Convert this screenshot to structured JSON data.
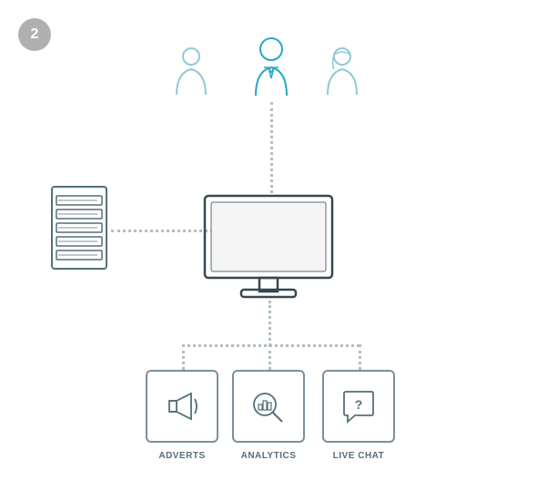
{
  "badge": {
    "number": "2"
  },
  "persons": {
    "left": {
      "label": "User Left",
      "color": "#90cad6"
    },
    "center": {
      "label": "User Center",
      "color": "#29a8c5"
    },
    "right": {
      "label": "User Right",
      "color": "#90cad6"
    }
  },
  "server": {
    "label": "Server"
  },
  "monitor": {
    "label": "Monitor/Computer"
  },
  "boxes": [
    {
      "id": "adverts",
      "label": "ADVERTS"
    },
    {
      "id": "analytics",
      "label": "ANALYTICS"
    },
    {
      "id": "livechat",
      "label": "LIVE CHAT"
    }
  ],
  "chat_label": "CHAT"
}
